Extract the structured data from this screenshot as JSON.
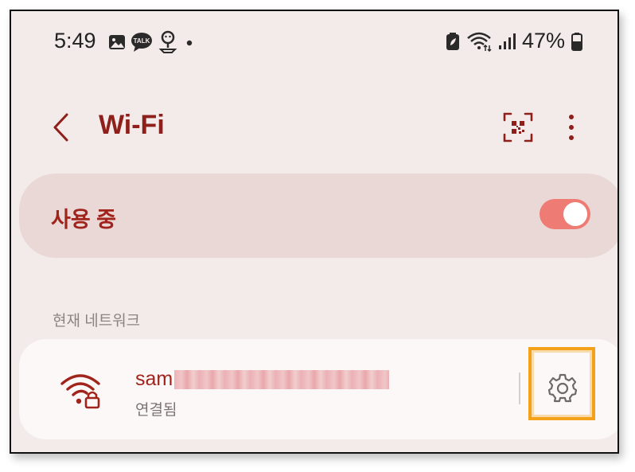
{
  "status_bar": {
    "time": "5:49",
    "battery": "47%",
    "icons_left": [
      "image-icon",
      "talk-icon",
      "location-pin-icon",
      "dot-icon"
    ],
    "icons_right": [
      "battery-saver-icon",
      "wifi-signal-icon",
      "cell-signal-icon",
      "battery-icon"
    ],
    "talk_label": "TALK"
  },
  "header": {
    "title": "Wi-Fi"
  },
  "wifi_toggle": {
    "label": "사용 중",
    "on": true
  },
  "section": {
    "current_network_label": "현재 네트워크"
  },
  "network": {
    "name_visible": "sam",
    "status": "연결됨"
  },
  "colors": {
    "accent": "#a0241c",
    "title": "#8e1f1b",
    "switch_on": "#ee7b74",
    "highlight": "#f5a21b",
    "background": "#f3ebe9"
  }
}
